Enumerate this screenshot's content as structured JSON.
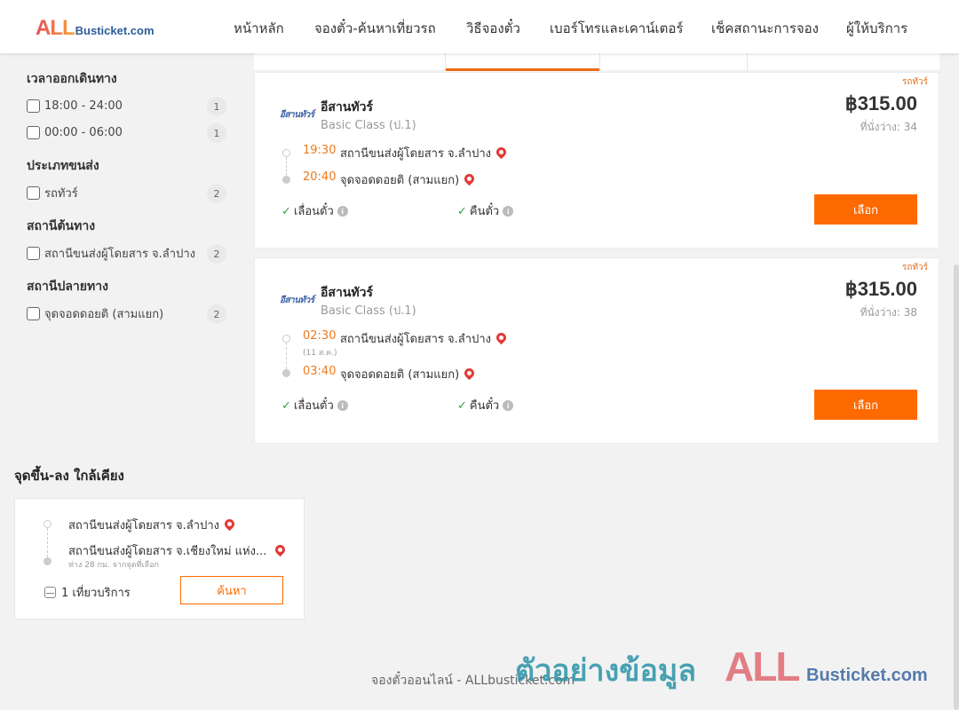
{
  "header": {
    "logo_all": "ALL",
    "logo_rest": "Busticket.com",
    "nav": [
      {
        "label": "หน้าหลัก"
      },
      {
        "label": "จองตั๋ว-ค้นหาเที่ยวรถ"
      },
      {
        "label": "วิธีจองตั๋ว"
      },
      {
        "label": "เบอร์โทรและเคาน์เตอร์"
      },
      {
        "label": "เช็คสถานะการจอง"
      },
      {
        "label": "ผู้ให้บริการ"
      }
    ]
  },
  "filters": {
    "departure_time": {
      "title": "เวลาออกเดินทาง",
      "options": [
        {
          "label": "18:00 - 24:00",
          "count": "1"
        },
        {
          "label": "00:00 - 06:00",
          "count": "1"
        }
      ]
    },
    "transport_type": {
      "title": "ประเภทขนส่ง",
      "options": [
        {
          "label": "รถทัวร์",
          "count": "2"
        }
      ]
    },
    "origin": {
      "title": "สถานีต้นทาง",
      "options": [
        {
          "label": "สถานีขนส่งผู้โดยสาร จ.ลำปาง",
          "count": "2"
        }
      ]
    },
    "destination": {
      "title": "สถานีปลายทาง",
      "options": [
        {
          "label": "จุดจอดดอยติ (สามแยก)",
          "count": "2"
        }
      ]
    }
  },
  "trips": [
    {
      "tag": "รถทัวร์",
      "operator_logo": "อีสานทัวร์",
      "operator": "อีสานทัวร์",
      "class": "Basic Class (ป.1)",
      "price": "฿315.00",
      "seats": "ที่นั่งว่าง: 34",
      "depart_time": "19:30",
      "depart_station": "สถานีขนส่งผู้โดยสาร จ.ลำปาง",
      "depart_date": "",
      "arrive_time": "20:40",
      "arrive_station": "จุดจอดดอยติ (สามแยก)",
      "feature_1": "เลื่อนตั๋ว",
      "feature_2": "คืนตั๋ว",
      "button": "เลือก"
    },
    {
      "tag": "รถทัวร์",
      "operator_logo": "อีสานทัวร์",
      "operator": "อีสานทัวร์",
      "class": "Basic Class (ป.1)",
      "price": "฿315.00",
      "seats": "ที่นั่งว่าง: 38",
      "depart_time": "02:30",
      "depart_station": "สถานีขนส่งผู้โดยสาร จ.ลำปาง",
      "depart_date": "(11 ส.ค.)",
      "arrive_time": "03:40",
      "arrive_station": "จุดจอดดอยติ (สามแยก)",
      "feature_1": "เลื่อนตั๋ว",
      "feature_2": "คืนตั๋ว",
      "button": "เลือก"
    }
  ],
  "nearby": {
    "title": "จุดขึ้น-ลง ใกล้เคียง",
    "from": "สถานีขนส่งผู้โดยสาร จ.ลำปาง",
    "to": "สถานีขนส่งผู้โดยสาร จ.เชียงใหม่ แห่ง...",
    "distance": "ห่าง 28 กม. จากจุดที่เลือก",
    "trips": "1 เที่ยวบริการ",
    "button": "ค้นหา"
  },
  "footer": {
    "text": "จองตั๋วออนไลน์ - ALLbusticket.com"
  },
  "watermark": {
    "thai": "ตัวอย่างข้อมูล",
    "all": "ALL",
    "rest": "Busticket.com"
  },
  "colors": {
    "accent": "#ff6a00",
    "time": "#ee7a1c",
    "check": "#2ea043",
    "pin": "#e53935"
  }
}
